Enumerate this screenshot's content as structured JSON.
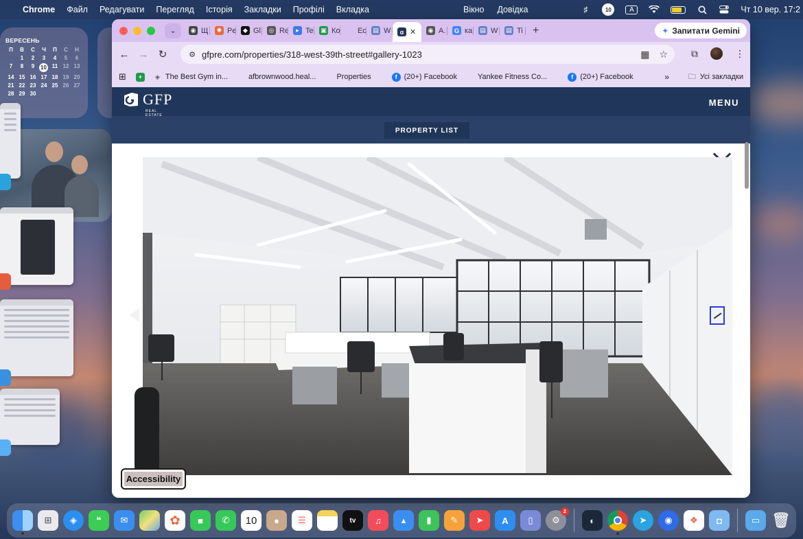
{
  "menubar": {
    "app_name": "Chrome",
    "menus": [
      "Файл",
      "Редагувати",
      "Перегляд",
      "Історія",
      "Закладки",
      "Профілі",
      "Вкладка"
    ],
    "menus_right": [
      "Вікно",
      "Довідка"
    ],
    "input_source": "A",
    "notification_count": "10",
    "datetime": "Чт 10 вер. 17:2"
  },
  "calendar_widget": {
    "month": "ВЕРЕСЕНЬ",
    "weekdays": [
      "П",
      "В",
      "С",
      "Ч",
      "П",
      "С",
      "Н"
    ],
    "days": [
      "",
      "1",
      "2",
      "3",
      "4",
      "5",
      "6",
      "7",
      "8",
      "9",
      "10",
      "11",
      "12",
      "13",
      "14",
      "15",
      "16",
      "17",
      "18",
      "19",
      "20",
      "21",
      "22",
      "23",
      "24",
      "25",
      "26",
      "27",
      "28",
      "29",
      "30"
    ],
    "today": "10"
  },
  "browser": {
    "tabs": [
      {
        "title": "Щ",
        "fav": "◉",
        "color": "#444"
      },
      {
        "title": "Pe",
        "fav": "✺",
        "color": "#e86a3a"
      },
      {
        "title": "Gl",
        "fav": "◆",
        "color": "#111"
      },
      {
        "title": "Re",
        "fav": "◎",
        "color": "#555"
      },
      {
        "title": "Te",
        "fav": "▸",
        "color": "#3d7be6"
      },
      {
        "title": "Ко",
        "fav": "▣",
        "color": "#1f9a4a"
      },
      {
        "title": "Ес",
        "fav": "",
        "color": "transparent"
      },
      {
        "title": "W",
        "fav": "▤",
        "color": "#6a7fc4"
      }
    ],
    "active_tab": {
      "fav": "ɑ"
    },
    "tabs_after": [
      {
        "title": "А.",
        "fav": "◉",
        "color": "#555"
      },
      {
        "title": "ка",
        "fav": "G",
        "color": "#4285f4"
      },
      {
        "title": "W",
        "fav": "▤",
        "color": "#6a7fc4"
      },
      {
        "title": "Ti",
        "fav": "▤",
        "color": "#6a7fc4"
      }
    ],
    "gemini_label": "Запитати Gemini",
    "url": "gfpre.com/properties/318-west-39th-street#gallery-1023",
    "bookmarks": [
      {
        "label": "The Best Gym in...",
        "fav": "◈",
        "color": "#777"
      },
      {
        "label": "afbrownwood.heal...",
        "fav": "",
        "color": "transparent"
      },
      {
        "label": "Properties",
        "fav": "",
        "color": "transparent"
      },
      {
        "label": "(20+) Facebook",
        "fav": "f",
        "color": "#1877f2"
      },
      {
        "label": "Yankee Fitness Co...",
        "fav": "",
        "color": "transparent"
      },
      {
        "label": "(20+) Facebook",
        "fav": "f",
        "color": "#1877f2"
      }
    ],
    "bookmarks_more": "»",
    "all_bookmarks": "Усі закладки"
  },
  "site": {
    "logo_text": "GFP",
    "logo_sub": "REAL ESTATE",
    "menu_label": "MENU",
    "property_list_label": "PROPERTY LIST",
    "accessibility_label": "Accessibility"
  },
  "dock": {
    "calendar_day": "10",
    "settings_badge": "2"
  }
}
